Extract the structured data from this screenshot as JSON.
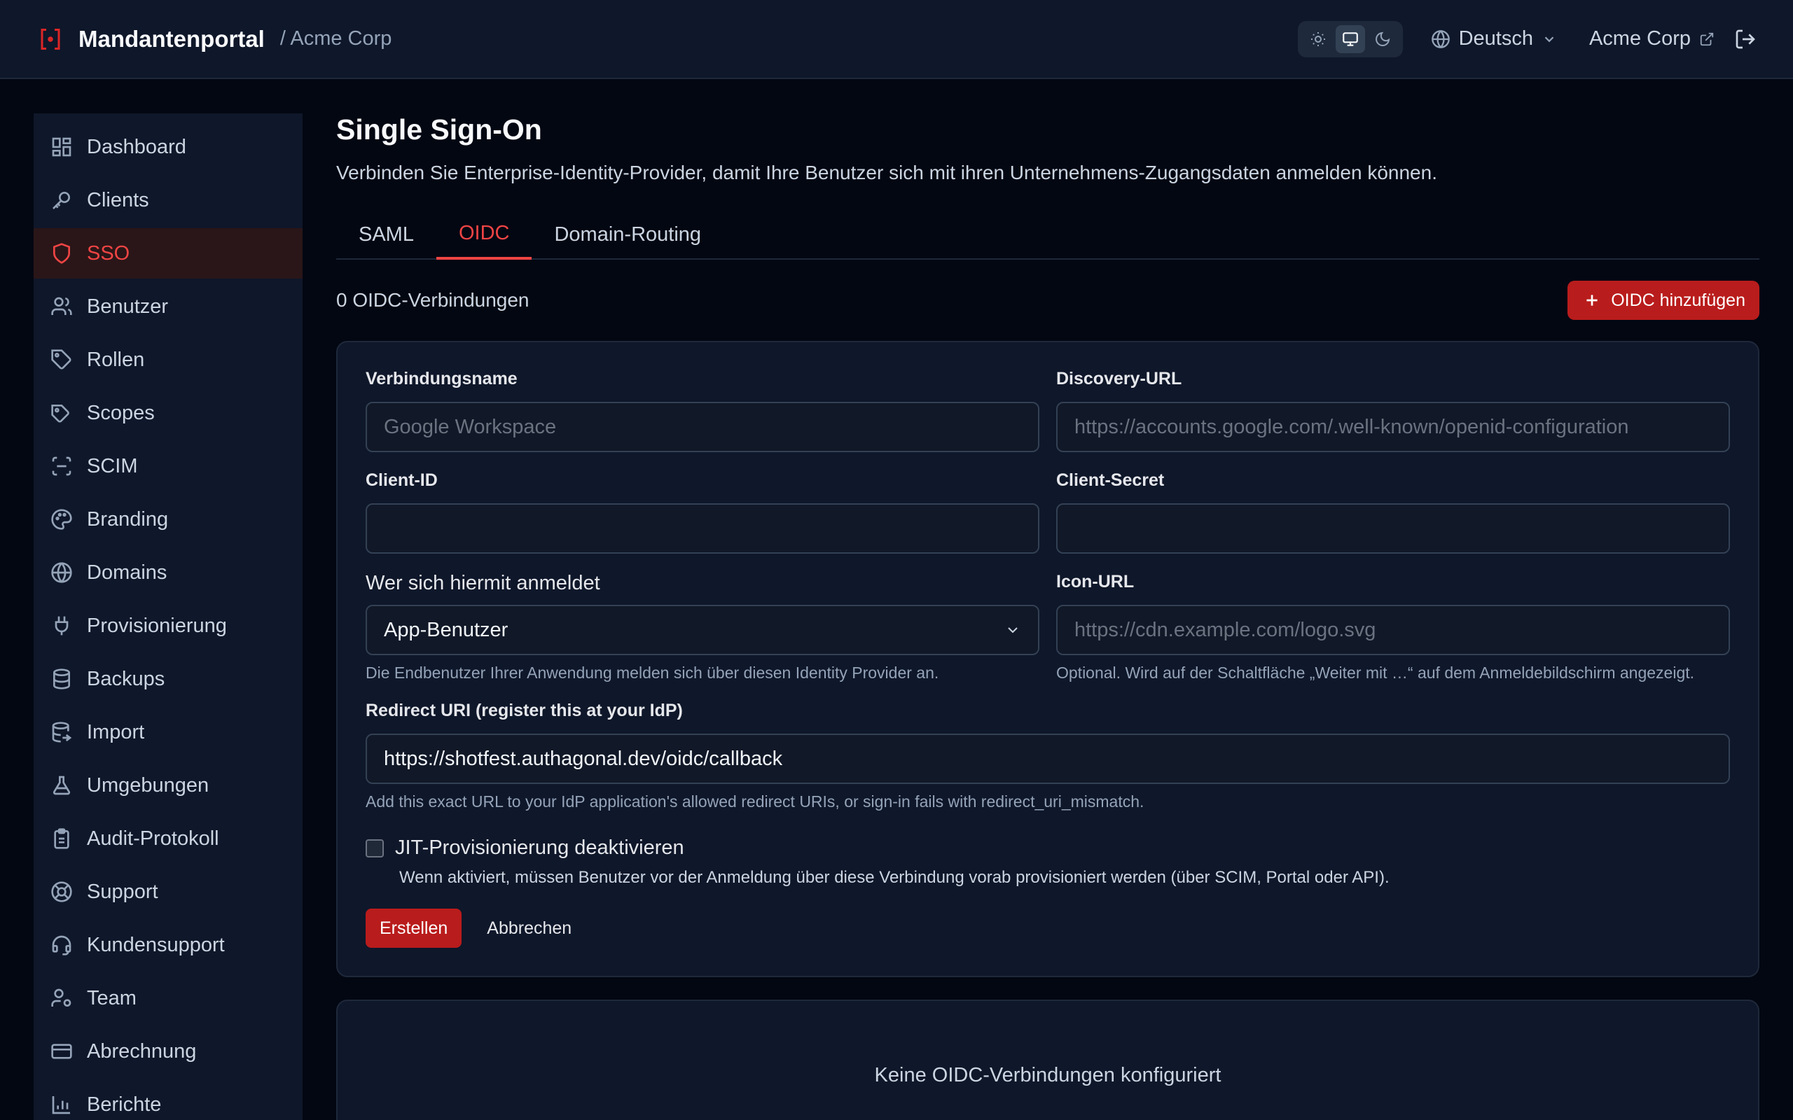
{
  "header": {
    "title": "Mandantenportal",
    "breadcrumb": "/ Acme Corp",
    "theme_modes": [
      "light",
      "system",
      "dark"
    ],
    "theme_selected": "system",
    "language": "Deutsch",
    "tenant_link": "Acme Corp"
  },
  "sidebar": {
    "items": [
      {
        "label": "Dashboard",
        "icon": "dashboard-icon"
      },
      {
        "label": "Clients",
        "icon": "key-icon"
      },
      {
        "label": "SSO",
        "icon": "shield-icon",
        "active": true
      },
      {
        "label": "Benutzer",
        "icon": "users-icon"
      },
      {
        "label": "Rollen",
        "icon": "tag-icon"
      },
      {
        "label": "Scopes",
        "icon": "tags-icon"
      },
      {
        "label": "SCIM",
        "icon": "scan-icon"
      },
      {
        "label": "Branding",
        "icon": "palette-icon"
      },
      {
        "label": "Domains",
        "icon": "globe-icon"
      },
      {
        "label": "Provisionierung",
        "icon": "plug-icon"
      },
      {
        "label": "Backups",
        "icon": "database-icon"
      },
      {
        "label": "Import",
        "icon": "database-import-icon"
      },
      {
        "label": "Umgebungen",
        "icon": "flask-icon"
      },
      {
        "label": "Audit-Protokoll",
        "icon": "clipboard-icon"
      },
      {
        "label": "Support",
        "icon": "lifebuoy-icon"
      },
      {
        "label": "Kundensupport",
        "icon": "headset-icon"
      },
      {
        "label": "Team",
        "icon": "user-cog-icon"
      },
      {
        "label": "Abrechnung",
        "icon": "credit-card-icon"
      },
      {
        "label": "Berichte",
        "icon": "bar-chart-icon"
      }
    ]
  },
  "page": {
    "title": "Single Sign-On",
    "description": "Verbinden Sie Enterprise-Identity-Provider, damit Ihre Benutzer sich mit ihren Unternehmens-Zugangsdaten anmelden können.",
    "tabs": [
      {
        "label": "SAML"
      },
      {
        "label": "OIDC",
        "active": true
      },
      {
        "label": "Domain-Routing"
      }
    ],
    "count_text": "0 OIDC-Verbindungen",
    "add_button": "OIDC hinzufügen"
  },
  "form": {
    "name_label": "Verbindungsname",
    "name_placeholder": "Google Workspace",
    "discovery_label": "Discovery-URL",
    "discovery_placeholder": "https://accounts.google.com/.well-known/openid-configuration",
    "client_id_label": "Client-ID",
    "client_id_value": "",
    "client_secret_label": "Client-Secret",
    "client_secret_value": "",
    "who_label": "Wer sich hiermit anmeldet",
    "who_value": "App-Benutzer",
    "who_hint": "Die Endbenutzer Ihrer Anwendung melden sich über diesen Identity Provider an.",
    "icon_label": "Icon-URL",
    "icon_placeholder": "https://cdn.example.com/logo.svg",
    "icon_hint": "Optional. Wird auf der Schaltfläche „Weiter mit …“ auf dem Anmeldebildschirm angezeigt.",
    "redirect_label": "Redirect URI (register this at your IdP)",
    "redirect_value": "https://shotfest.authagonal.dev/oidc/callback",
    "redirect_hint": "Add this exact URL to your IdP application's allowed redirect URIs, or sign-in fails with redirect_uri_mismatch.",
    "jit_label": "JIT-Provisionierung deaktivieren",
    "jit_checked": false,
    "jit_hint": "Wenn aktiviert, müssen Benutzer vor der Anmeldung über diese Verbindung vorab provisioniert werden (über SCIM, Portal oder API).",
    "create_button": "Erstellen",
    "cancel_button": "Abbrechen"
  },
  "empty_state": "Keine OIDC-Verbindungen konfiguriert",
  "colors": {
    "accent": "#dc2626",
    "background": "#030712",
    "panel": "#0f172a"
  }
}
